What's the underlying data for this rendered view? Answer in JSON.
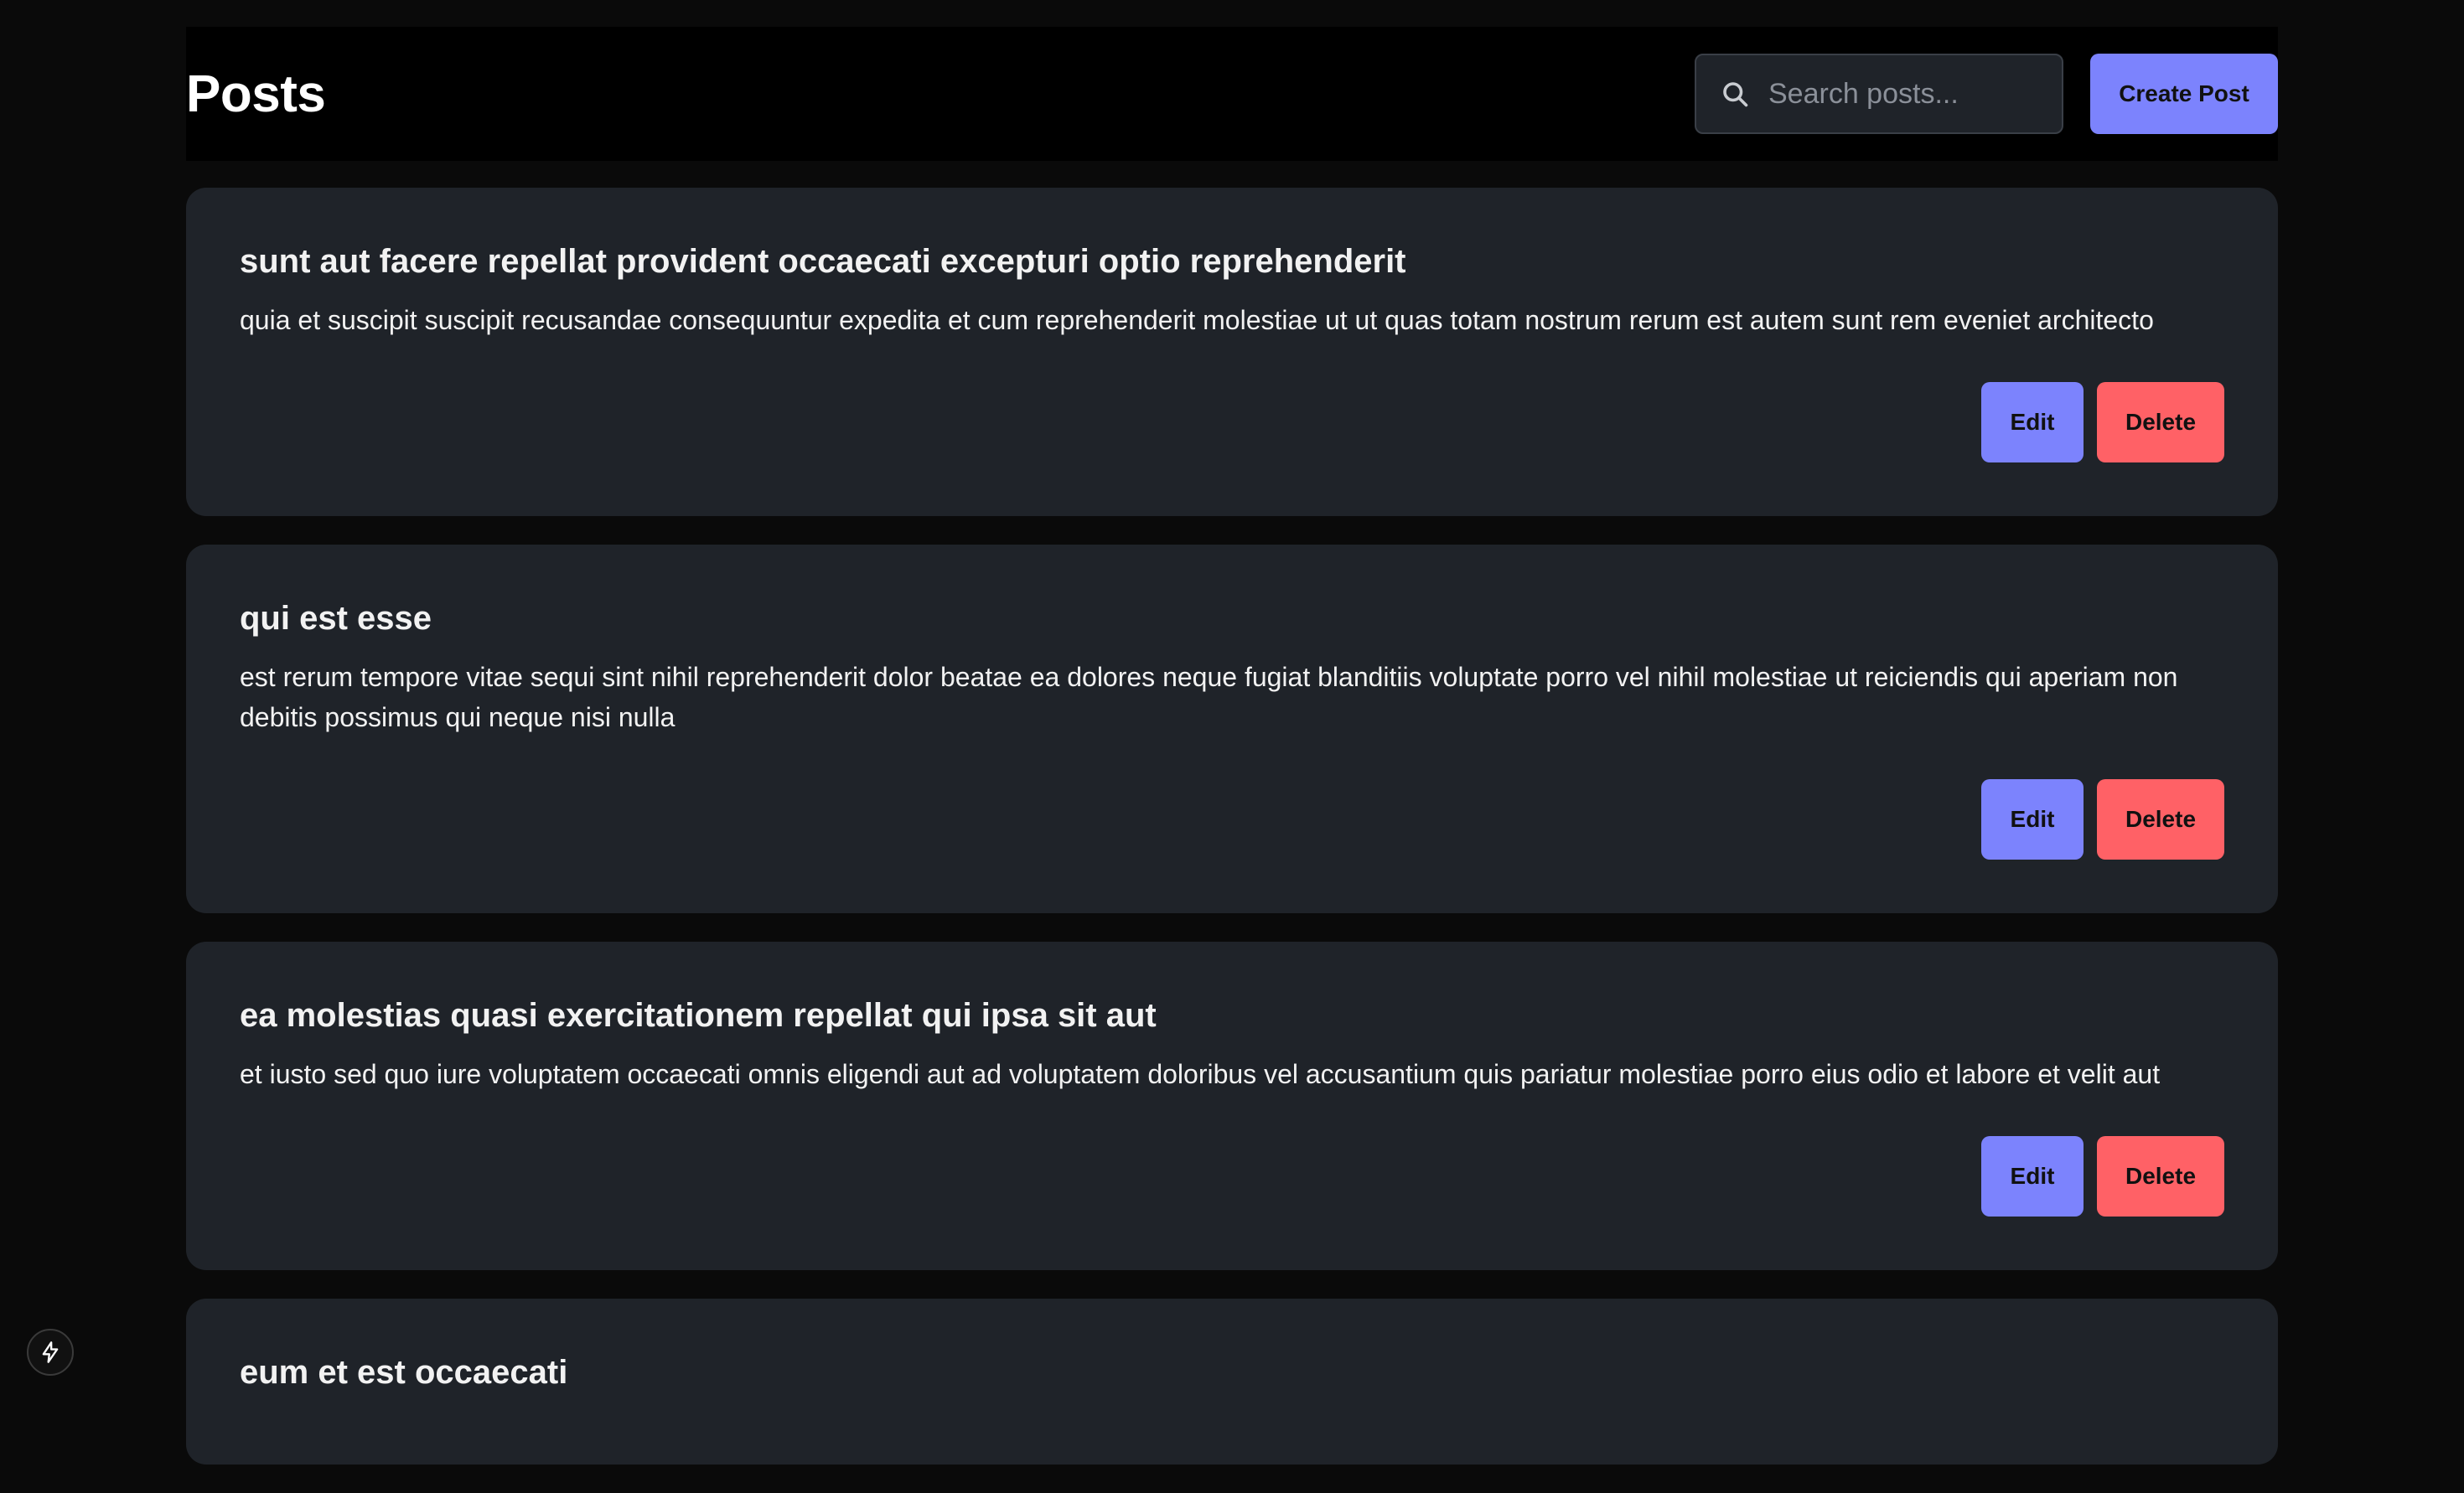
{
  "header": {
    "title": "Posts",
    "search_placeholder": "Search posts...",
    "create_label": "Create Post"
  },
  "posts": [
    {
      "title": "sunt aut facere repellat provident occaecati excepturi optio reprehenderit",
      "body": "quia et suscipit suscipit recusandae consequuntur expedita et cum reprehenderit molestiae ut ut quas totam nostrum rerum est autem sunt rem eveniet architecto",
      "edit_label": "Edit",
      "delete_label": "Delete"
    },
    {
      "title": "qui est esse",
      "body": "est rerum tempore vitae sequi sint nihil reprehenderit dolor beatae ea dolores neque fugiat blanditiis voluptate porro vel nihil molestiae ut reiciendis qui aperiam non debitis possimus qui neque nisi nulla",
      "edit_label": "Edit",
      "delete_label": "Delete"
    },
    {
      "title": "ea molestias quasi exercitationem repellat qui ipsa sit aut",
      "body": "et iusto sed quo iure voluptatem occaecati omnis eligendi aut ad voluptatem doloribus vel accusantium quis pariatur molestiae porro eius odio et labore et velit aut",
      "edit_label": "Edit",
      "delete_label": "Delete"
    },
    {
      "title": "eum et est occaecati"
    }
  ],
  "colors": {
    "background": "#0a0a0a",
    "card": "#1f2329",
    "primary": "#7c83fd",
    "danger": "#ff6166"
  },
  "icons": {
    "search": "search-icon",
    "dev_tools": "lightning-icon"
  }
}
